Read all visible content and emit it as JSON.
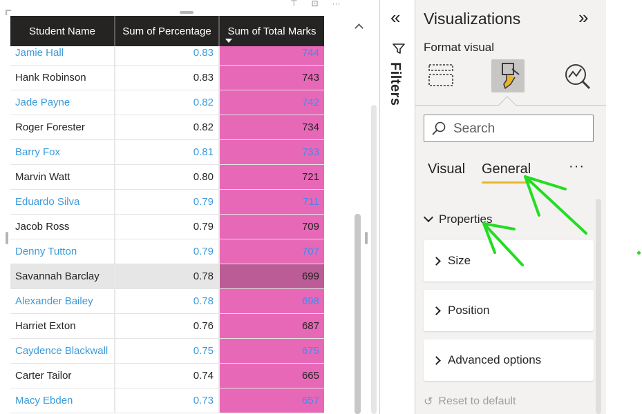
{
  "table": {
    "headers": [
      "Student Name",
      "Sum of Percentage",
      "Sum of Total Marks"
    ],
    "rows": [
      {
        "name": "Jamie Hall",
        "pct": "0.83",
        "marks": "744",
        "style": "link"
      },
      {
        "name": "Hank Robinson",
        "pct": "0.83",
        "marks": "743",
        "style": "plain"
      },
      {
        "name": "Jade Payne",
        "pct": "0.82",
        "marks": "742",
        "style": "link"
      },
      {
        "name": "Roger Forester",
        "pct": "0.82",
        "marks": "734",
        "style": "plain"
      },
      {
        "name": "Barry Fox",
        "pct": "0.81",
        "marks": "733",
        "style": "link"
      },
      {
        "name": "Marvin Watt",
        "pct": "0.80",
        "marks": "721",
        "style": "plain"
      },
      {
        "name": "Eduardo Silva",
        "pct": "0.79",
        "marks": "711",
        "style": "link"
      },
      {
        "name": "Jacob Ross",
        "pct": "0.79",
        "marks": "709",
        "style": "plain"
      },
      {
        "name": "Denny Tutton",
        "pct": "0.79",
        "marks": "707",
        "style": "link"
      },
      {
        "name": "Savannah Barclay",
        "pct": "0.78",
        "marks": "699",
        "style": "selected"
      },
      {
        "name": "Alexander Bailey",
        "pct": "0.78",
        "marks": "698",
        "style": "link"
      },
      {
        "name": "Harriet Exton",
        "pct": "0.76",
        "marks": "687",
        "style": "plain"
      },
      {
        "name": "Caydence Blackwall",
        "pct": "0.75",
        "marks": "675",
        "style": "link"
      },
      {
        "name": "Carter Tailor",
        "pct": "0.74",
        "marks": "665",
        "style": "plain"
      },
      {
        "name": "Macy Ebden",
        "pct": "0.73",
        "marks": "657",
        "style": "link"
      }
    ],
    "colors": {
      "header_bg": "#252423",
      "marks_fill": "#e868b8",
      "marks_fill_selected": "#bb5c96",
      "link_text": "#3a9ad9"
    }
  },
  "filters": {
    "label": "Filters"
  },
  "visualizations": {
    "title": "Visualizations",
    "subtitle": "Format visual",
    "icons": [
      "build-visual-icon",
      "format-visual-icon",
      "analytics-icon"
    ],
    "search_placeholder": "Search",
    "tabs": [
      "Visual",
      "General"
    ],
    "active_tab": "General",
    "more": "···",
    "section": "Properties",
    "cards": [
      "Size",
      "Position",
      "Advanced options"
    ],
    "reset_label": "Reset to default"
  }
}
